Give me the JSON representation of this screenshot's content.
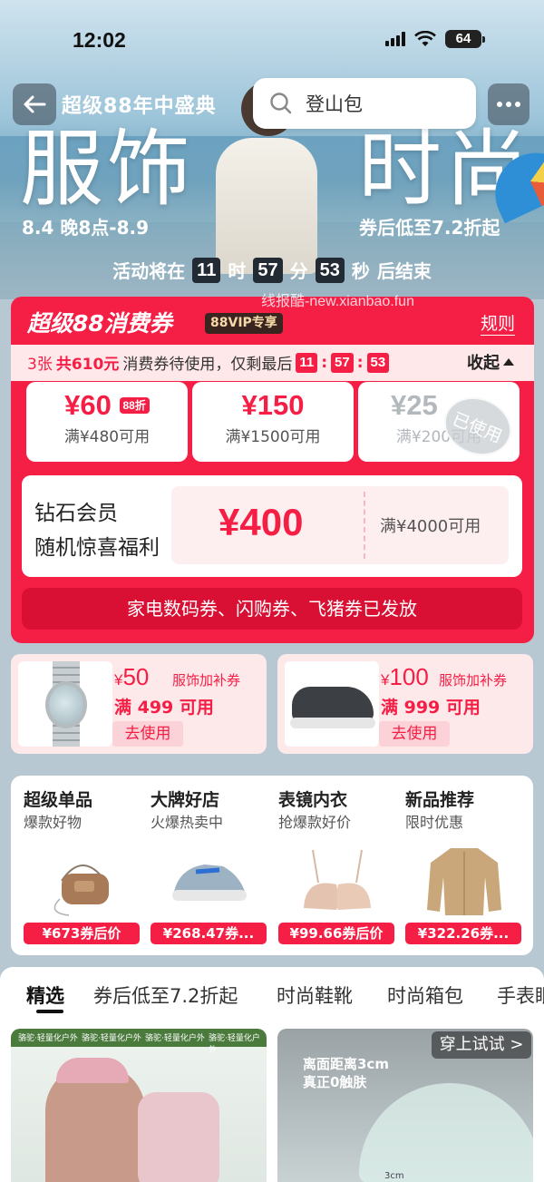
{
  "status_bar": {
    "time": "12:02",
    "battery": "64"
  },
  "header": {
    "event_title": "超级88年中盛典",
    "search_placeholder": "登山包",
    "hero_word_left": "服饰",
    "hero_word_right": "时尚",
    "date_range": "8.4 晚8点-8.9",
    "discount_text": "券后低至7.2折起"
  },
  "countdown": {
    "prefix": "活动将在",
    "hours": "11",
    "hour_unit": "时",
    "minutes": "57",
    "minute_unit": "分",
    "seconds": "53",
    "second_unit": "秒",
    "suffix": "后结束"
  },
  "watermark": "线报酷-new.xianbao.fun",
  "coupon_card": {
    "title": "超级88消费券",
    "vip_badge": "88VIP专享",
    "rules": "规则",
    "info_prefix": "3张",
    "info_highlight": "共610元",
    "info_middle": "消费券待使用，仅剩最后",
    "timer": [
      "11",
      "57",
      "53"
    ],
    "collapse": "收起",
    "coupons": [
      {
        "amount": "¥60",
        "tag": "88折",
        "condition": "满¥480可用"
      },
      {
        "amount": "¥150",
        "condition": "满¥1500可用"
      },
      {
        "amount": "¥25",
        "condition": "满¥200可用",
        "stamp": "已使用"
      }
    ],
    "diamond": {
      "line1": "钻石会员",
      "line2": "随机惊喜福利",
      "amount": "¥400",
      "condition": "满¥4000可用"
    },
    "issued_notice": "家电数码券、闪购券、飞猪券已发放"
  },
  "product_vouchers": [
    {
      "currency": "¥",
      "amount": "50",
      "kind": "服饰加补券",
      "min": "满 499 可用",
      "button": "去使用"
    },
    {
      "currency": "¥",
      "amount": "100",
      "kind": "服饰加补券",
      "min": "满 999 可用",
      "button": "去使用"
    }
  ],
  "categories": [
    {
      "title": "超级单品",
      "subtitle": "爆款好物",
      "price": "¥673券后价"
    },
    {
      "title": "大牌好店",
      "subtitle": "火爆热卖中",
      "price": "¥268.47券..."
    },
    {
      "title": "表镜内衣",
      "subtitle": "抢爆款好价",
      "price": "¥99.66券后价"
    },
    {
      "title": "新品推荐",
      "subtitle": "限时优惠",
      "price": "¥322.26券..."
    }
  ],
  "tabs": [
    "精选",
    "券后低至7.2折起",
    "时尚鞋靴",
    "时尚箱包",
    "手表眼"
  ],
  "feed": {
    "brand_strip": [
      "骆驼·轻量化户外",
      "骆驼·轻量化户外",
      "骆驼·轻量化户外",
      "骆驼·轻量化户外"
    ],
    "try_on": "穿上试试 >",
    "promo_line1": "离面距离3cm",
    "promo_line2": "真正0触肤",
    "measure": "3cm"
  }
}
